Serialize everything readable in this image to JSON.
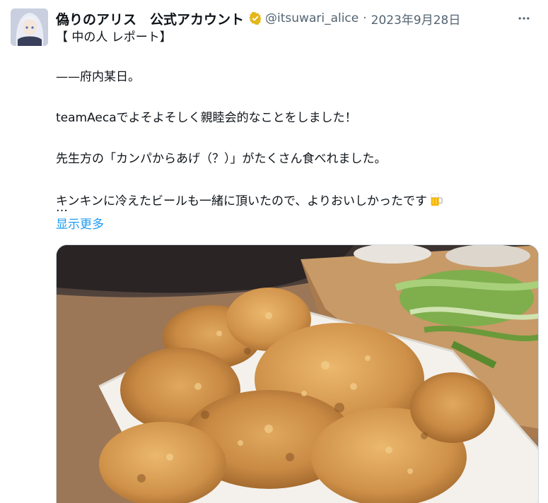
{
  "tweet": {
    "display_name": "偽りのアリス　公式アカウント",
    "handle": "@itsuwari_alice",
    "separator": "·",
    "date": "2023年9月28日",
    "lines": [
      "【 中の人 レポート】",
      "——府内某日。",
      "teamAecaでよそよそしく親睦会的なことをしました！",
      "先生方の「カンパからあげ（？）」がたくさん食べれました。",
      "キンキンに冷えたビールも一緒に頂いたので、よりおいしかったです"
    ],
    "emoji": "beer-mug-emoji",
    "ellipsis": "…",
    "show_more": "显示更多"
  },
  "icons": {
    "verified": "verified-badge-gold-icon",
    "more": "more-horizontal-icon"
  },
  "colors": {
    "text": "#0f1419",
    "secondary": "#536471",
    "link": "#1d9bf0",
    "verified_gold": "#e2b719"
  }
}
